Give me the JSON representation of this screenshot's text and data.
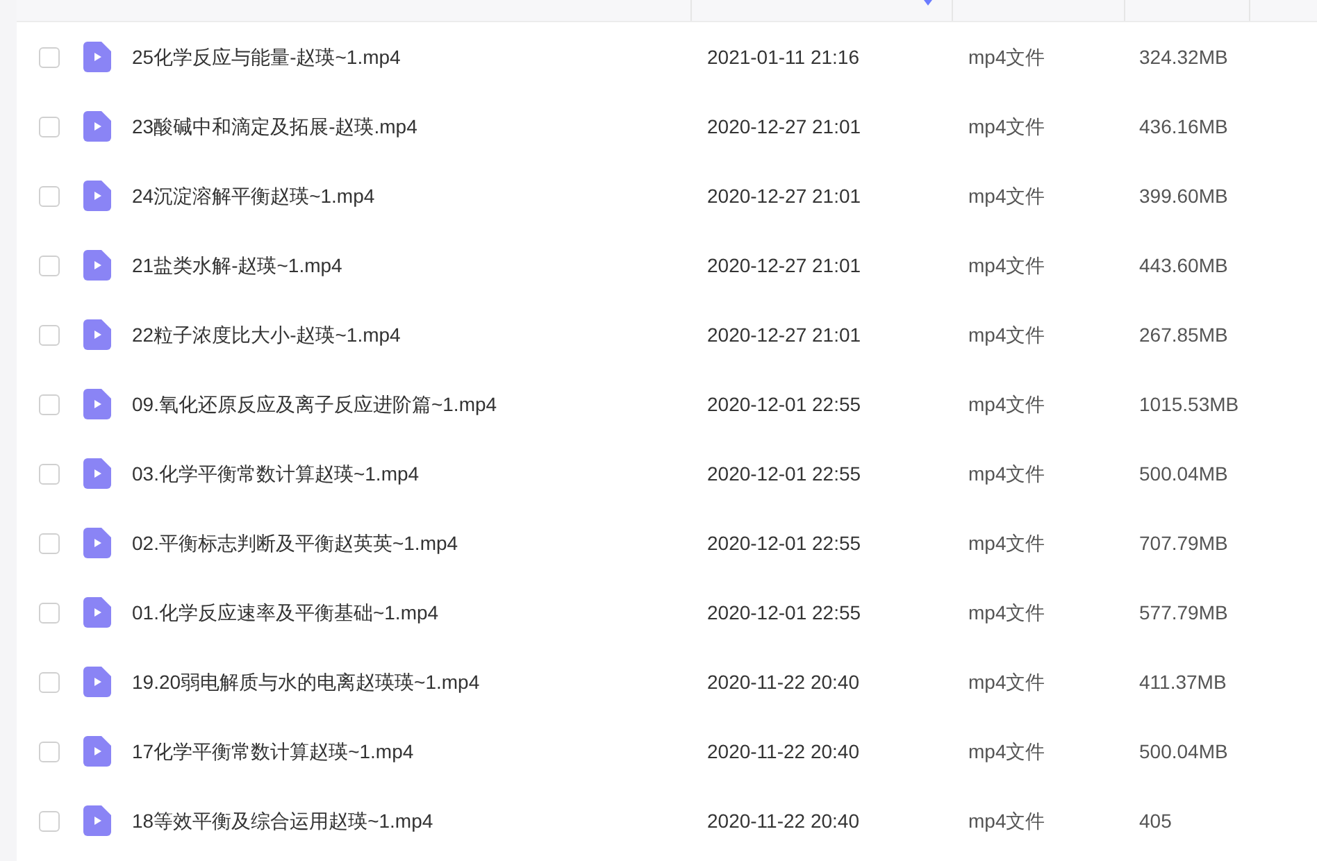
{
  "files": [
    {
      "name": "25化学反应与能量-赵瑛~1.mp4",
      "modified": "2021-01-11 21:16",
      "type": "mp4文件",
      "size": "324.32MB",
      "checked": false
    },
    {
      "name": "23酸碱中和滴定及拓展-赵瑛.mp4",
      "modified": "2020-12-27 21:01",
      "type": "mp4文件",
      "size": "436.16MB",
      "checked": false
    },
    {
      "name": "24沉淀溶解平衡赵瑛~1.mp4",
      "modified": "2020-12-27 21:01",
      "type": "mp4文件",
      "size": "399.60MB",
      "checked": false
    },
    {
      "name": "21盐类水解-赵瑛~1.mp4",
      "modified": "2020-12-27 21:01",
      "type": "mp4文件",
      "size": "443.60MB",
      "checked": false
    },
    {
      "name": "22粒子浓度比大小-赵瑛~1.mp4",
      "modified": "2020-12-27 21:01",
      "type": "mp4文件",
      "size": "267.85MB",
      "checked": false
    },
    {
      "name": "09.氧化还原反应及离子反应进阶篇~1.mp4",
      "modified": "2020-12-01 22:55",
      "type": "mp4文件",
      "size": "1015.53MB",
      "checked": false
    },
    {
      "name": "03.化学平衡常数计算赵瑛~1.mp4",
      "modified": "2020-12-01 22:55",
      "type": "mp4文件",
      "size": "500.04MB",
      "checked": false
    },
    {
      "name": "02.平衡标志判断及平衡赵英英~1.mp4",
      "modified": "2020-12-01 22:55",
      "type": "mp4文件",
      "size": "707.79MB",
      "checked": false
    },
    {
      "name": "01.化学反应速率及平衡基础~1.mp4",
      "modified": "2020-12-01 22:55",
      "type": "mp4文件",
      "size": "577.79MB",
      "checked": false
    },
    {
      "name": "19.20弱电解质与水的电离赵瑛瑛~1.mp4",
      "modified": "2020-11-22 20:40",
      "type": "mp4文件",
      "size": "411.37MB",
      "checked": false
    },
    {
      "name": "17化学平衡常数计算赵瑛~1.mp4",
      "modified": "2020-11-22 20:40",
      "type": "mp4文件",
      "size": "500.04MB",
      "checked": false
    },
    {
      "name": "18等效平衡及综合运用赵瑛~1.mp4",
      "modified": "2020-11-22 20:40",
      "type": "mp4文件",
      "size": "405",
      "checked": false
    }
  ]
}
